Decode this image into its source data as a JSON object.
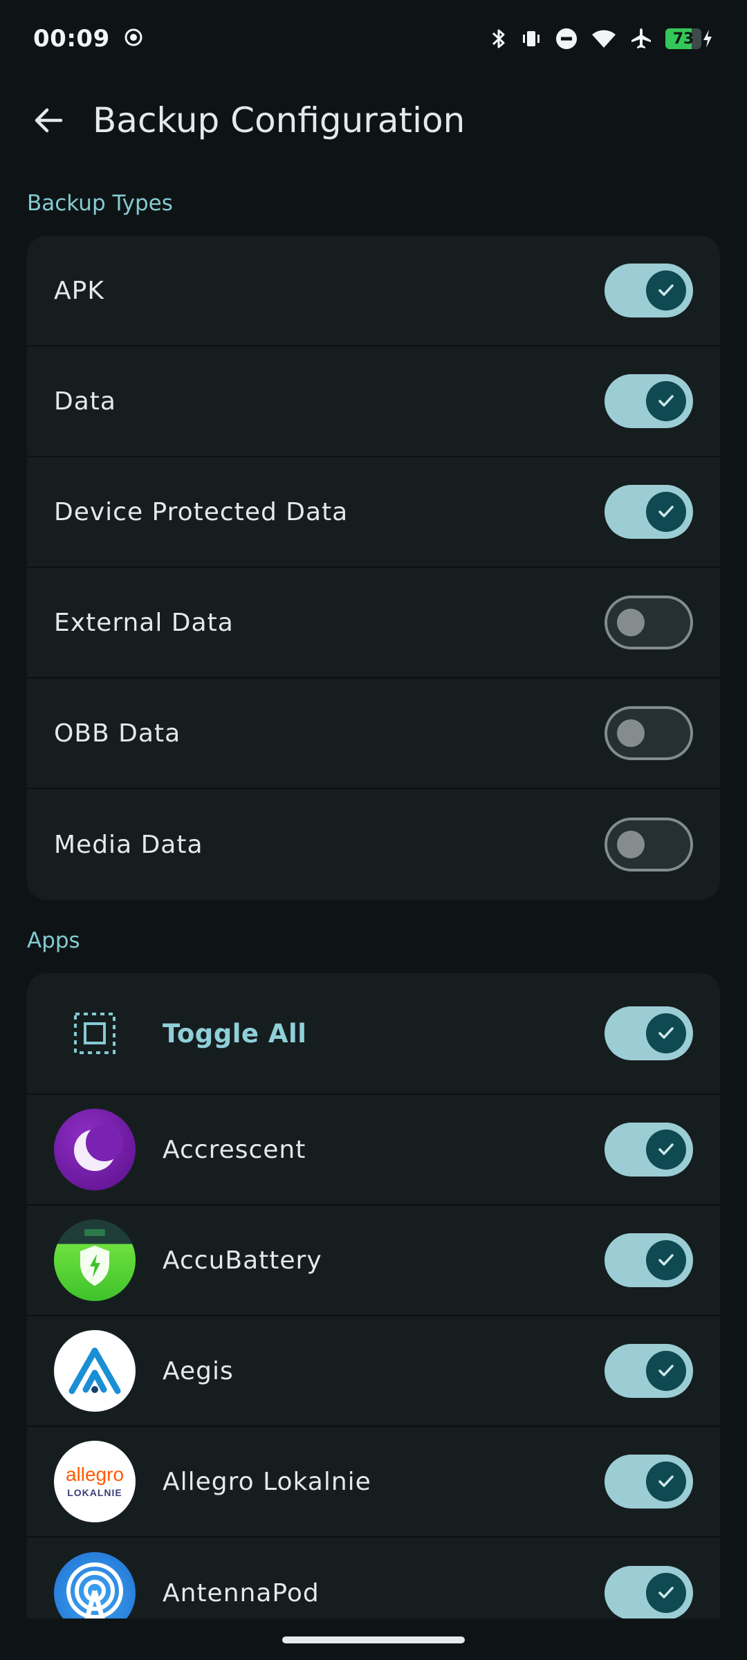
{
  "status_bar": {
    "time": "00:09",
    "battery_percent": "73"
  },
  "app_bar": {
    "title": "Backup Configuration"
  },
  "backup_types": {
    "heading": "Backup Types",
    "items": [
      {
        "label": "APK",
        "enabled": true
      },
      {
        "label": "Data",
        "enabled": true
      },
      {
        "label": "Device Protected Data",
        "enabled": true
      },
      {
        "label": "External Data",
        "enabled": false
      },
      {
        "label": "OBB Data",
        "enabled": false
      },
      {
        "label": "Media Data",
        "enabled": false
      }
    ]
  },
  "apps": {
    "heading": "Apps",
    "toggle_all": {
      "label": "Toggle All",
      "enabled": true
    },
    "items": [
      {
        "name": "Accrescent",
        "icon": "accrescent-icon",
        "enabled": true
      },
      {
        "name": "AccuBattery",
        "icon": "accubattery-icon",
        "enabled": true
      },
      {
        "name": "Aegis",
        "icon": "aegis-icon",
        "enabled": true
      },
      {
        "name": "Allegro Lokalnie",
        "icon": "allegro-lokalnie-icon",
        "enabled": true,
        "icon_text": {
          "top": "allegro",
          "bottom": "LOKALNIE"
        }
      },
      {
        "name": "AntennaPod",
        "icon": "antennapod-icon",
        "enabled": true
      }
    ]
  },
  "colors": {
    "background": "#0e1415",
    "card": "#161d1f",
    "accent": "#85cbd3",
    "switch_on_track": "#9ccdd5",
    "switch_on_knob": "#0f4a52",
    "battery_green": "#35c759"
  }
}
